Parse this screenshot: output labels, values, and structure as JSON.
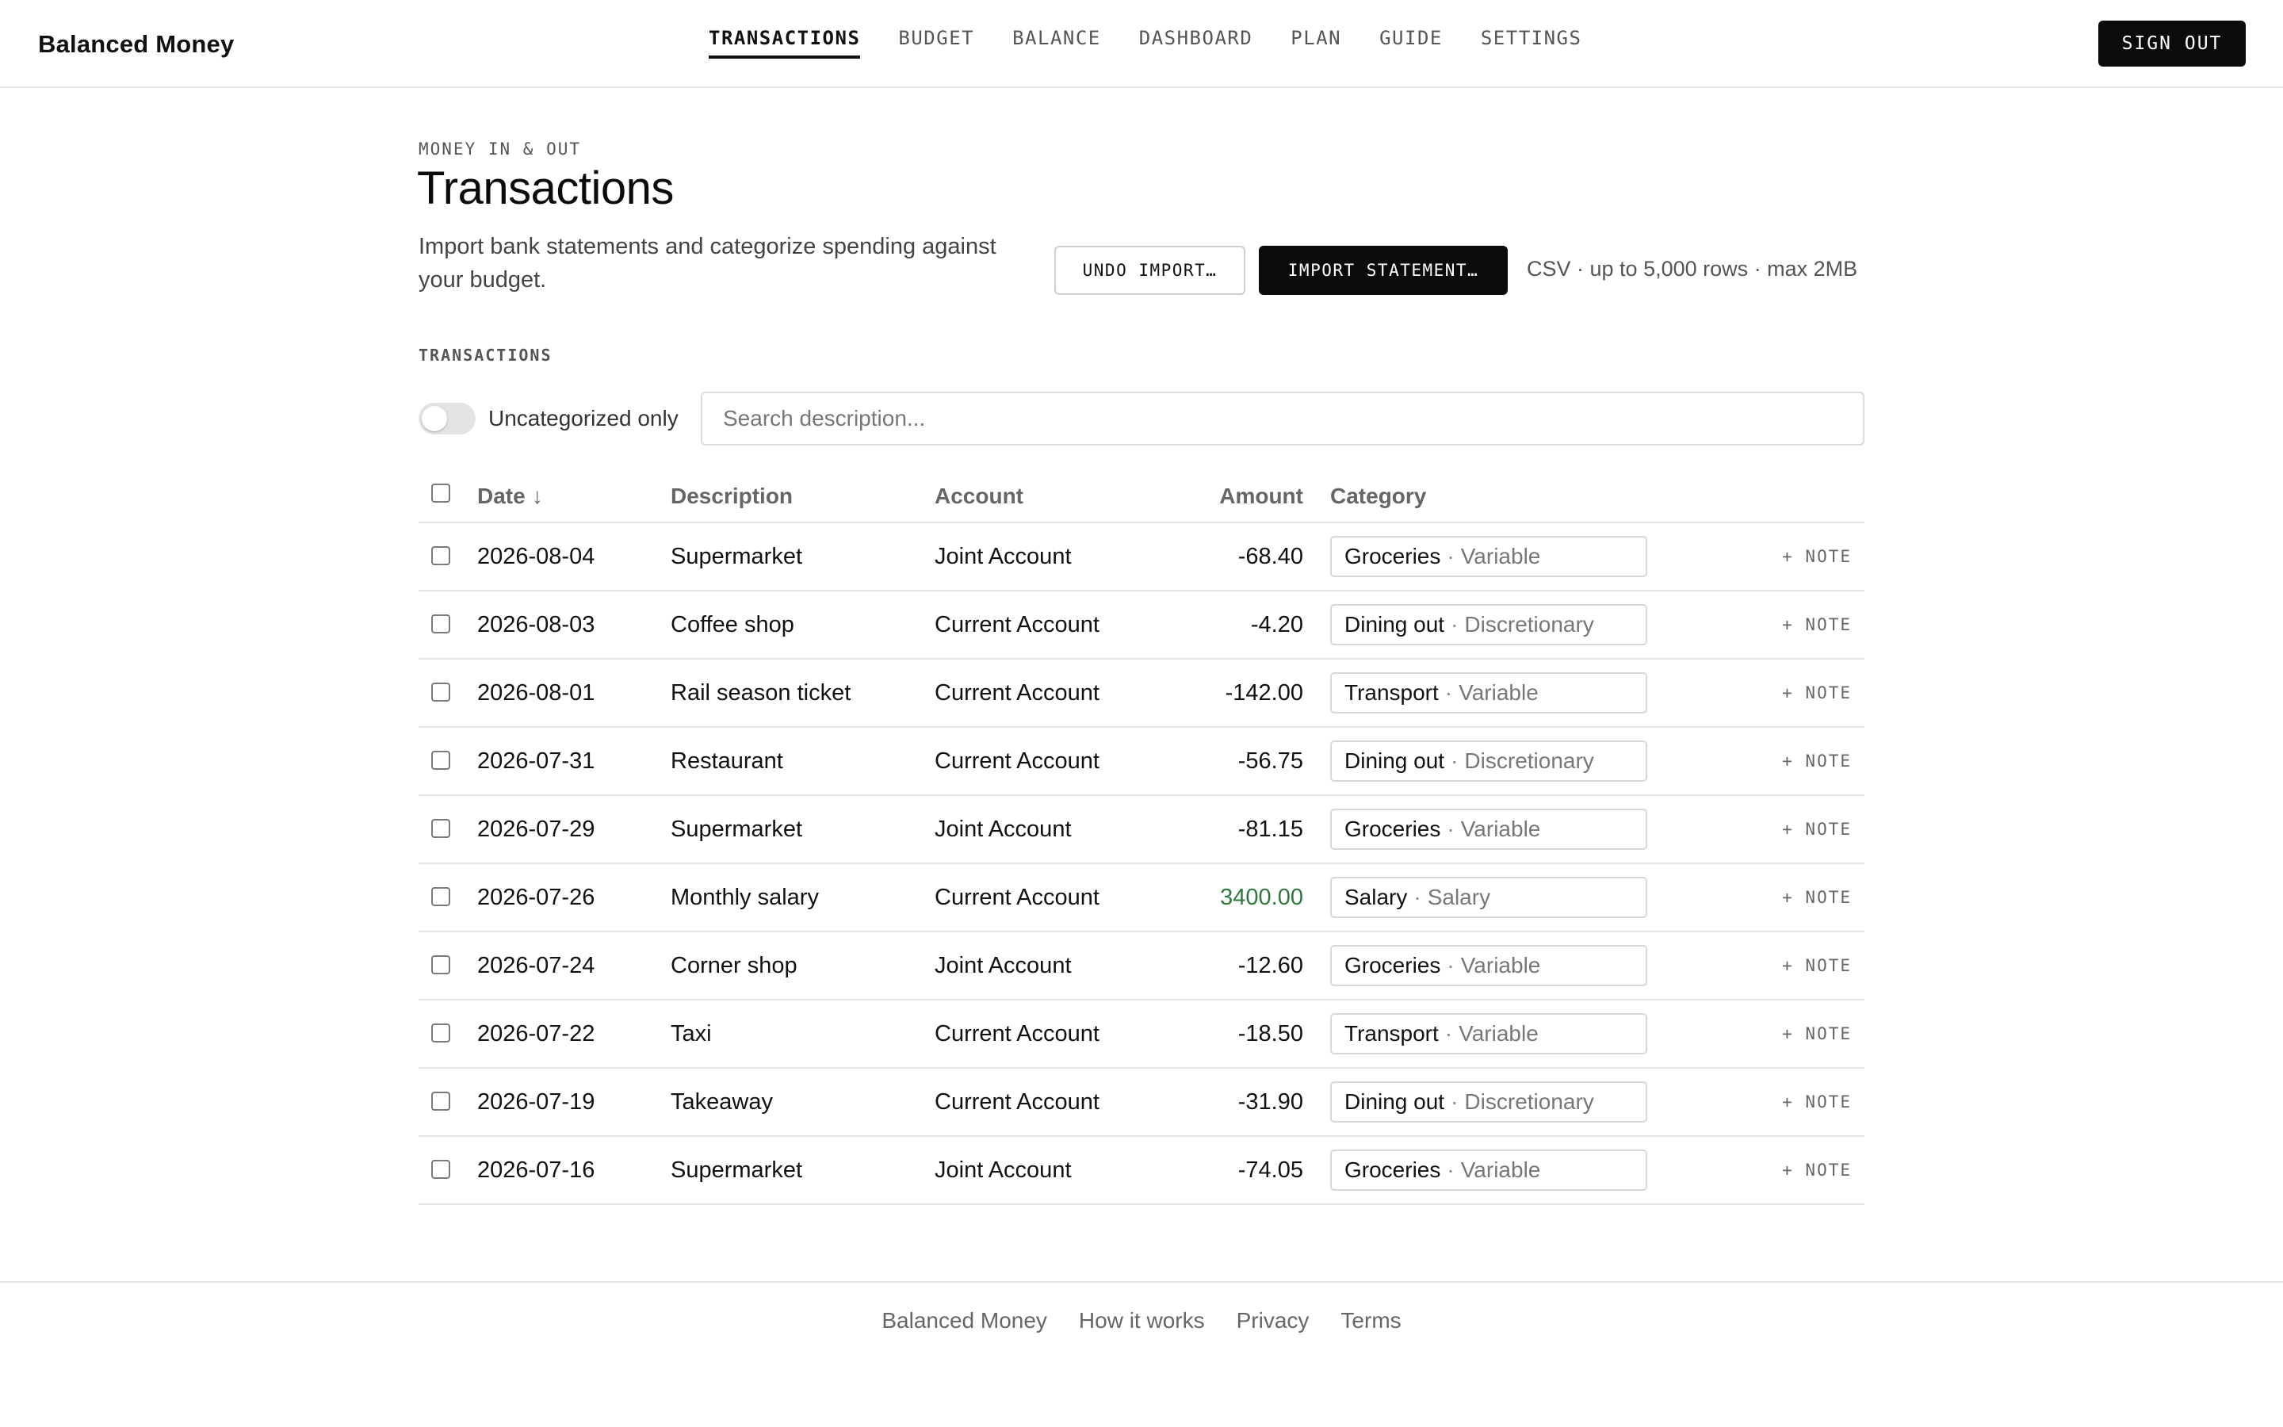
{
  "brand": "Balanced Money",
  "nav": {
    "items": [
      "TRANSACTIONS",
      "BUDGET",
      "BALANCE",
      "DASHBOARD",
      "PLAN",
      "GUIDE",
      "SETTINGS"
    ],
    "active": "TRANSACTIONS",
    "sign_out": "SIGN OUT"
  },
  "header": {
    "eyebrow": "MONEY IN & OUT",
    "title": "Transactions",
    "subtitle": "Import bank statements and categorize spending against your budget.",
    "undo_label": "UNDO IMPORT…",
    "import_label": "IMPORT STATEMENT…",
    "import_hint": "CSV · up to 5,000 rows · max 2MB"
  },
  "section_label": "TRANSACTIONS",
  "filters": {
    "toggle_label": "Uncategorized only",
    "toggle_on": false,
    "search_placeholder": "Search description..."
  },
  "table": {
    "headers": {
      "date": "Date",
      "date_sort_arrow": "↓",
      "description": "Description",
      "account": "Account",
      "amount": "Amount",
      "category": "Category"
    },
    "note_label": "+ NOTE",
    "rows": [
      {
        "date": "2026-08-04",
        "description": "Supermarket",
        "account": "Joint Account",
        "amount": "-68.40",
        "category": "Groceries",
        "group": "Variable"
      },
      {
        "date": "2026-08-03",
        "description": "Coffee shop",
        "account": "Current Account",
        "amount": "-4.20",
        "category": "Dining out",
        "group": "Discretionary"
      },
      {
        "date": "2026-08-01",
        "description": "Rail season ticket",
        "account": "Current Account",
        "amount": "-142.00",
        "category": "Transport",
        "group": "Variable"
      },
      {
        "date": "2026-07-31",
        "description": "Restaurant",
        "account": "Current Account",
        "amount": "-56.75",
        "category": "Dining out",
        "group": "Discretionary"
      },
      {
        "date": "2026-07-29",
        "description": "Supermarket",
        "account": "Joint Account",
        "amount": "-81.15",
        "category": "Groceries",
        "group": "Variable"
      },
      {
        "date": "2026-07-26",
        "description": "Monthly salary",
        "account": "Current Account",
        "amount": "3400.00",
        "category": "Salary",
        "group": "Salary"
      },
      {
        "date": "2026-07-24",
        "description": "Corner shop",
        "account": "Joint Account",
        "amount": "-12.60",
        "category": "Groceries",
        "group": "Variable"
      },
      {
        "date": "2026-07-22",
        "description": "Taxi",
        "account": "Current Account",
        "amount": "-18.50",
        "category": "Transport",
        "group": "Variable"
      },
      {
        "date": "2026-07-19",
        "description": "Takeaway",
        "account": "Current Account",
        "amount": "-31.90",
        "category": "Dining out",
        "group": "Discretionary"
      },
      {
        "date": "2026-07-16",
        "description": "Supermarket",
        "account": "Joint Account",
        "amount": "-74.05",
        "category": "Groceries",
        "group": "Variable"
      }
    ]
  },
  "footer": {
    "links": [
      "Balanced Money",
      "How it works",
      "Privacy",
      "Terms"
    ]
  },
  "colors": {
    "accent": "#0b0b0b",
    "positive_amount": "#2d7a3e",
    "border": "#e4e4e4"
  }
}
